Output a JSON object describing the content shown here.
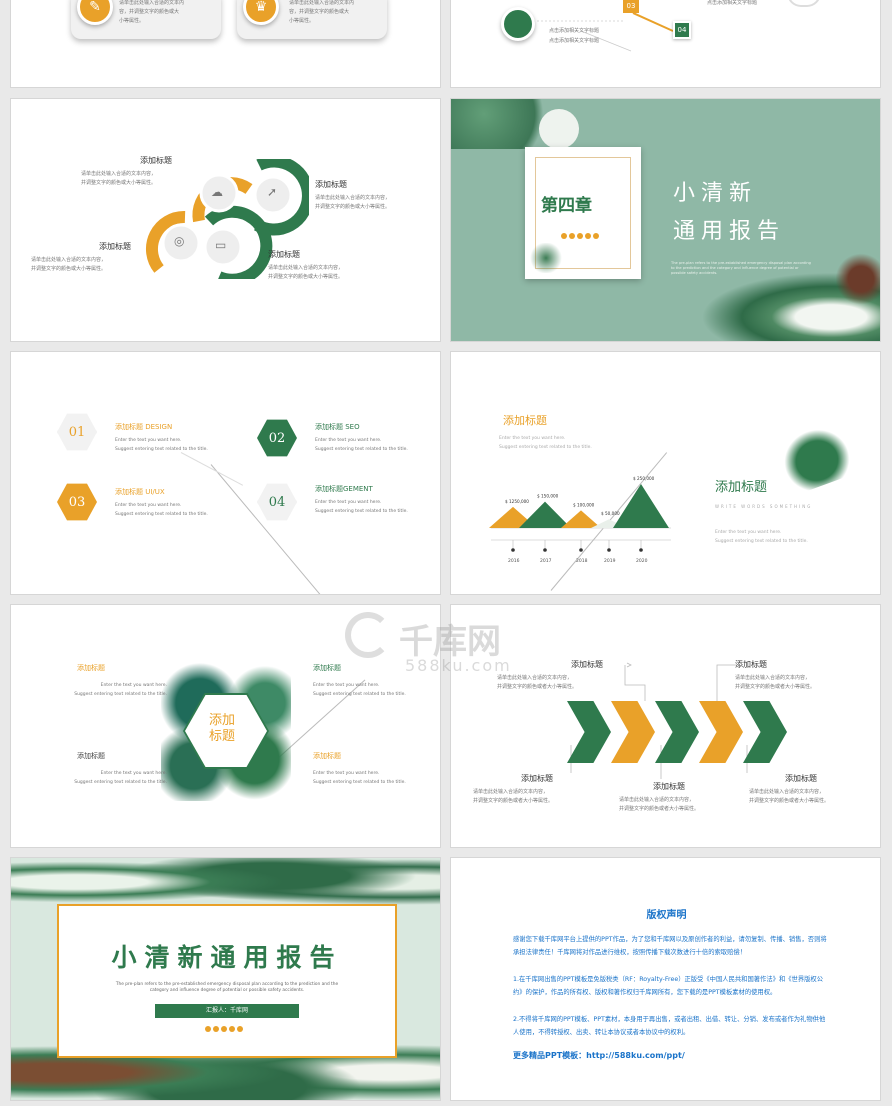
{
  "colors": {
    "green": "#2f7a4d",
    "orange": "#e9a129",
    "mint": "#8fb8a6",
    "blue": "#1a73c9"
  },
  "s1": {
    "text1": "请单击此处输入合适的文本内",
    "text2": "容，并调整文字的颜色或大",
    "text3": "小等属性。",
    "text4": "请单击此处输入合适的文本内",
    "text5": "容，并调整文字的颜色或大",
    "text6": "小等属性。",
    "icon1": "pencil-icon",
    "icon2": "trophy-icon"
  },
  "s2": {
    "top_text": "点击添加相关文字标题",
    "num3": "03",
    "num4": "04",
    "line1": "点击添加相关文字标题",
    "line2": "点击添加相关文字标题"
  },
  "s3": {
    "blocks": [
      {
        "title": "添加标题",
        "l1": "请单击此处输入合适的文本内容，",
        "l2": "并调整文字的颜色或大小等属性。"
      },
      {
        "title": "添加标题",
        "l1": "请单击此处输入合适的文本内容，",
        "l2": "并调整文字的颜色或大小等属性。"
      },
      {
        "title": "添加标题",
        "l1": "请单击此处输入合适的文本内容，",
        "l2": "并调整文字的颜色或大小等属性。"
      },
      {
        "title": "添加标题",
        "l1": "请单击此处输入合适的文本内容，",
        "l2": "并调整文字的颜色或大小等属性。"
      }
    ],
    "icons": [
      "cloud-icon",
      "cursor-icon",
      "brain-icon",
      "chat-icon"
    ]
  },
  "s4": {
    "chapter": "第四章",
    "title1": "小清新",
    "title2": "通用报告",
    "sub": "The pre-plan refers to the pre-established emergency disposal plan according to the prediction and the category and influence degree of potential or possible safety accidents."
  },
  "s5": {
    "items": [
      {
        "num": "01",
        "title": "添加标题 DESIGN",
        "l1": "Enter the text you want here.",
        "l2": "Suggest entering text related to the title."
      },
      {
        "num": "02",
        "title": "添加标题 SEO",
        "l1": "Enter the text you want here.",
        "l2": "Suggest entering text related to the title."
      },
      {
        "num": "03",
        "title": "添加标题 UI/UX",
        "l1": "Enter the text you want here.",
        "l2": "Suggest entering text related to the title."
      },
      {
        "num": "04",
        "title": "添加标题GEMENT",
        "l1": "Enter the text you want here.",
        "l2": "Suggest entering text related to the title."
      }
    ]
  },
  "s6": {
    "title": "添加标题",
    "l1": "Enter the text you want here.",
    "l2": "Suggest entering text related to the title.",
    "right_title": "添加标题",
    "right_sub": "WRITE WORDS SOMETHING",
    "r1": "Enter the text you want here.",
    "r2": "Suggest entering text related to the title."
  },
  "chart_data": {
    "type": "area",
    "categories": [
      "2016",
      "2017",
      "2018",
      "2019",
      "2020"
    ],
    "values": [
      120000,
      150000,
      100000,
      50000,
      250000
    ],
    "data_labels": [
      "$ 1250,000",
      "$ 150,000",
      "$ 100,000",
      "$ 50,000",
      "$ 250,000"
    ]
  },
  "s7": {
    "center1": "添加",
    "center2": "标题",
    "blocks": [
      {
        "title": "添加标题",
        "l1": "Enter the text you want here.",
        "l2": "Suggest entering text related to the title."
      },
      {
        "title": "添加标题",
        "l1": "Enter the text you want here.",
        "l2": "Suggest entering text related to the title."
      },
      {
        "title": "添加标题",
        "l1": "Enter the text you want here.",
        "l2": "Suggest entering text related to the title."
      },
      {
        "title": "添加标题",
        "l1": "Enter the text you want here.",
        "l2": "Suggest entering text related to the title."
      }
    ]
  },
  "s8": {
    "blocks": [
      {
        "title": "添加标题",
        "l1": "请单击此处输入合适的文本内容，",
        "l2": "并调整文字的颜色或者大小等属性。"
      },
      {
        "title": "添加标题",
        "l1": "请单击此处输入合适的文本内容，",
        "l2": "并调整文字的颜色或者大小等属性。"
      },
      {
        "title": "添加标题",
        "l1": "请单击此处输入合适的文本内容，",
        "l2": "并调整文字的颜色或者大小等属性。"
      },
      {
        "title": "添加标题",
        "l1": "请单击此处输入合适的文本内容，",
        "l2": "并调整文字的颜色或者大小等属性。"
      },
      {
        "title": "添加标题",
        "l1": "请单击此处输入合适的文本内容，",
        "l2": "并调整文字的颜色或者大小等属性。"
      }
    ]
  },
  "s9": {
    "title": "小清新通用报告",
    "sub1": "The pre-plan refers to the pre-established emergency disposal plan according to the prediction and the",
    "sub2": "category and influence degree of potential or possible safety accidents.",
    "reporter": "汇报人：千库网"
  },
  "s10": {
    "title": "版权声明",
    "p1": "感谢您下载千库网平台上提供的PPT作品，为了您和千库网以及原创作者的利益，请勿复制、传播、销售，否则将承担法律责任！千库网将对作品进行维权，按照传播下载次数进行十倍的索取赔偿！",
    "p2": "1.在千库网出售的PPT模板是免版税类（RF：Royalty-Free）正版受《中国人民共和国著作法》和《世界版权公约》的保护，作品的所有权、版权和著作权归千库网所有，您下载的是PPT模板素材的使用权。",
    "p3": "2.不得将千库网的PPT模板、PPT素材，本身用于再出售，或者出租、出借、转让、分销、发布或者作为礼物供他人使用，不得转授权、出卖、转让本协议或者本协议中的权利。",
    "more": "更多精品PPT模板：http://588ku.com/ppt/"
  },
  "watermark": {
    "brand": "千库网",
    "domain": "588ku.com"
  }
}
